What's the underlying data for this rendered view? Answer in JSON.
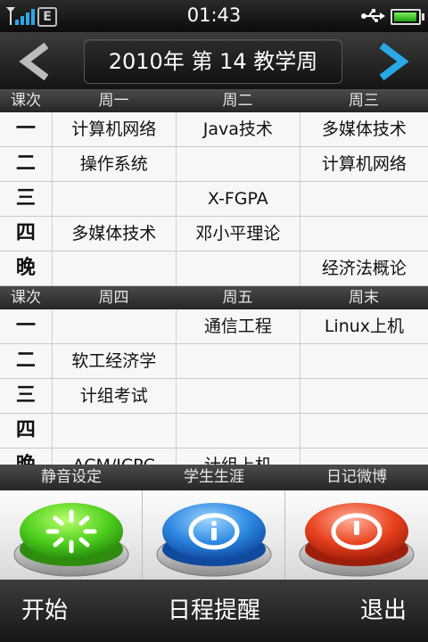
{
  "status_bar": {
    "time": "01:43",
    "network_type": "E",
    "signal_bars": 4,
    "battery_level": 0.95,
    "icons": [
      "signal-icon",
      "usb-icon",
      "battery-icon"
    ]
  },
  "header": {
    "week_title": "2010年 第 14 教学周",
    "prev_icon": "chevron-left-icon",
    "next_icon": "chevron-right-icon",
    "prev_color": "#bcbcbc",
    "next_color": "#29a8e8"
  },
  "schedule": {
    "top": {
      "columns": [
        "课次",
        "周一",
        "周二",
        "周三"
      ],
      "rows": [
        [
          "一",
          "计算机网络",
          "Java技术",
          "多媒体技术"
        ],
        [
          "二",
          "操作系统",
          "",
          "计算机网络"
        ],
        [
          "三",
          "",
          "X-FGPA",
          ""
        ],
        [
          "四",
          "多媒体技术",
          "邓小平理论",
          ""
        ],
        [
          "晚",
          "",
          "",
          "经济法概论"
        ]
      ]
    },
    "bottom": {
      "columns": [
        "课次",
        "周四",
        "周五",
        "周末"
      ],
      "rows": [
        [
          "一",
          "",
          "通信工程",
          "Linux上机"
        ],
        [
          "二",
          "软工经济学",
          "",
          ""
        ],
        [
          "三",
          "计组考试",
          "",
          ""
        ],
        [
          "四",
          "",
          "",
          ""
        ],
        [
          "晚",
          "ACM/ICPC",
          "计组上机",
          ""
        ]
      ]
    }
  },
  "function_buttons": [
    {
      "label": "静音设定",
      "icon": "mute-icon",
      "color": "#3cb81c"
    },
    {
      "label": "学生生涯",
      "icon": "info-icon",
      "color": "#1f78d6"
    },
    {
      "label": "日记微博",
      "icon": "alert-icon",
      "color": "#e0321a"
    }
  ],
  "toolbar": {
    "start_label": "开始",
    "reminder_label": "日程提醒",
    "exit_label": "退出"
  }
}
